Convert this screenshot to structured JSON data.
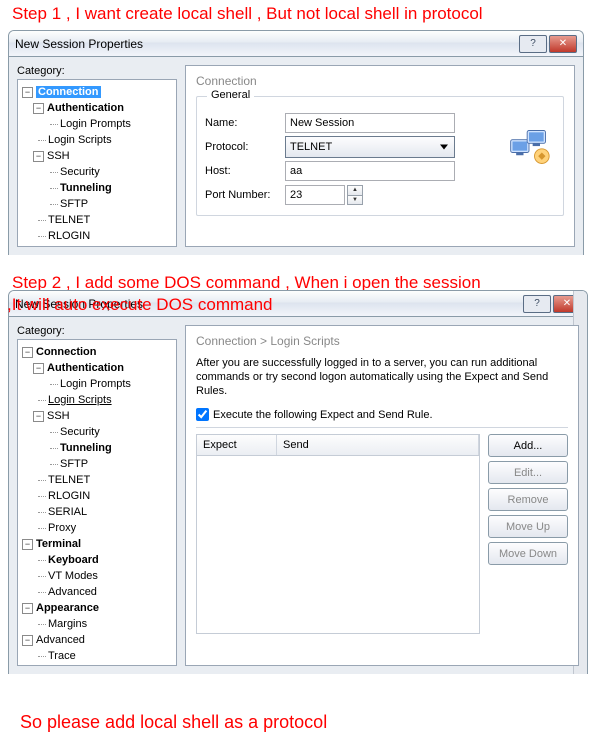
{
  "annotations": {
    "step1": "Step 1 , I want create local shell , But not local shell in protocol",
    "step2a": "Step 2 , I add some DOS command , When i open the session",
    "step2b": ",It will auto execute DOS command",
    "conclusion": "So please add local shell as a protocol"
  },
  "window1": {
    "title": "New Session Properties",
    "category_label": "Category:",
    "tree": {
      "connection": "Connection",
      "authentication": "Authentication",
      "login_prompts": "Login Prompts",
      "login_scripts": "Login Scripts",
      "ssh": "SSH",
      "security": "Security",
      "tunneling": "Tunneling",
      "sftp": "SFTP",
      "telnet": "TELNET",
      "rlogin": "RLOGIN"
    },
    "pane": {
      "breadcrumb": "Connection",
      "general_label": "General",
      "name_label": "Name:",
      "name_value": "New Session",
      "protocol_label": "Protocol:",
      "protocol_value": "TELNET",
      "host_label": "Host:",
      "host_value": "aa",
      "port_label": "Port Number:",
      "port_value": "23"
    }
  },
  "window2": {
    "title": "New Session Properties",
    "category_label": "Category:",
    "tree": {
      "connection": "Connection",
      "authentication": "Authentication",
      "login_prompts": "Login Prompts",
      "login_scripts": "Login Scripts",
      "ssh": "SSH",
      "security": "Security",
      "tunneling": "Tunneling",
      "sftp": "SFTP",
      "telnet": "TELNET",
      "rlogin": "RLOGIN",
      "serial": "SERIAL",
      "proxy": "Proxy",
      "terminal": "Terminal",
      "keyboard": "Keyboard",
      "vt_modes": "VT Modes",
      "advanced": "Advanced",
      "appearance": "Appearance",
      "margins": "Margins",
      "advanced_top": "Advanced",
      "trace": "Trace"
    },
    "pane": {
      "breadcrumb": "Connection > Login Scripts",
      "description": "After you are successfully logged in to a server, you can run additional commands or try second logon automatically using the Expect and Send Rules.",
      "execute_label": "Execute the following Expect and Send Rule.",
      "col_expect": "Expect",
      "col_send": "Send",
      "btn_add": "Add...",
      "btn_edit": "Edit...",
      "btn_remove": "Remove",
      "btn_moveup": "Move Up",
      "btn_movedown": "Move Down"
    }
  }
}
